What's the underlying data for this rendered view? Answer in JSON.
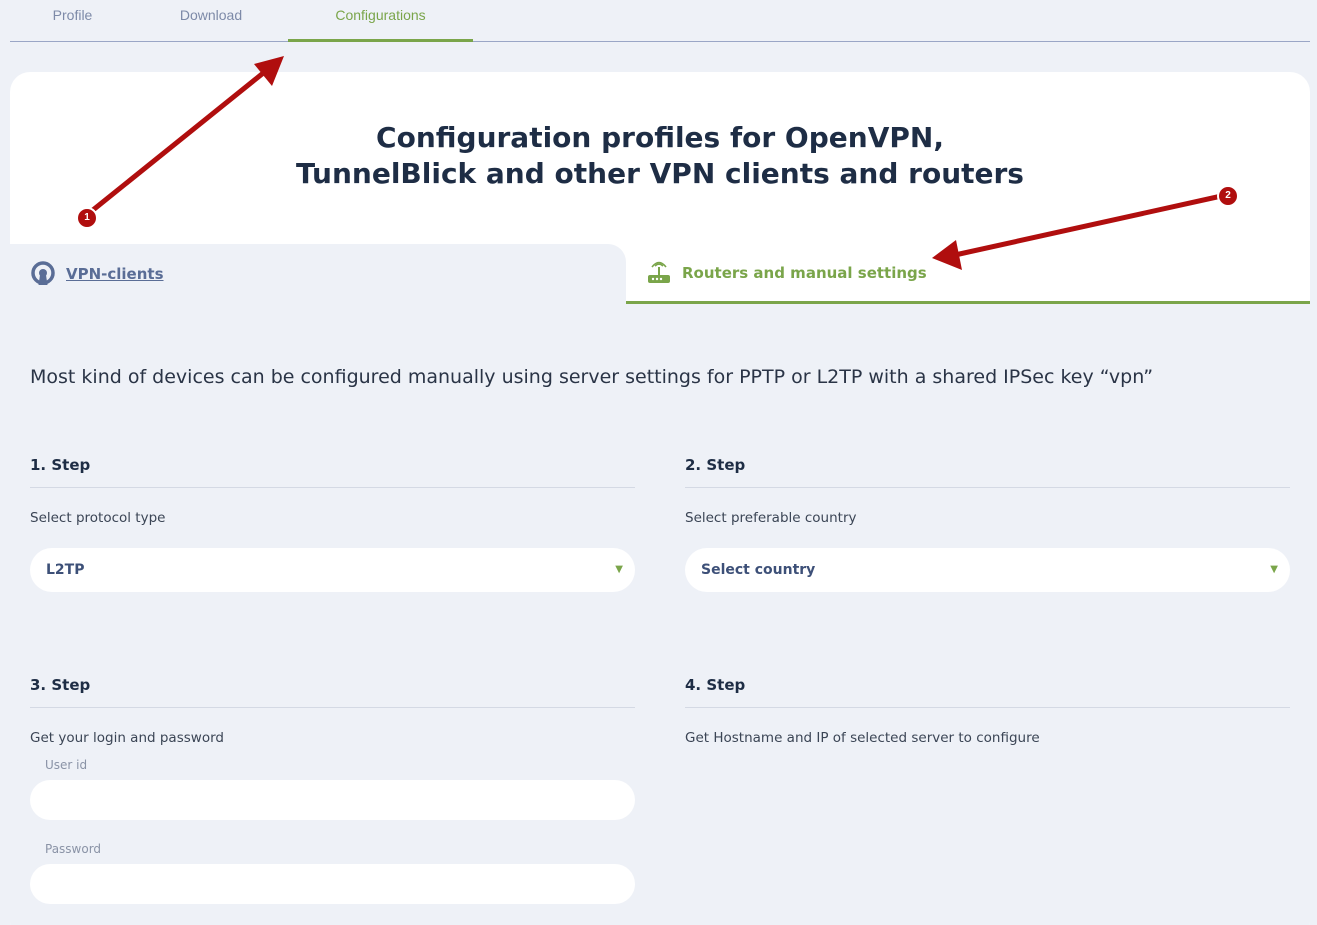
{
  "topnav": {
    "tabs": [
      {
        "label": "Profile"
      },
      {
        "label": "Download"
      },
      {
        "label": "Configurations"
      }
    ]
  },
  "card": {
    "title_line1": "Configuration profiles for OpenVPN,",
    "title_line2": "TunnelBlick and other VPN clients and routers"
  },
  "subtabs": {
    "vpn_clients": "VPN-clients",
    "routers": "Routers and manual settings"
  },
  "intro": "Most kind of devices can be configured manually using server settings for PPTP or L2TP with a shared IPSec key “vpn”",
  "steps": [
    {
      "head": "1. Step",
      "desc": "Select protocol type",
      "select_value": "L2TP"
    },
    {
      "head": "2. Step",
      "desc": "Select preferable country",
      "select_value": "Select country"
    },
    {
      "head": "3. Step",
      "desc": "Get your login and password",
      "user_label": "User id",
      "password_label": "Password"
    },
    {
      "head": "4. Step",
      "desc": "Get Hostname and IP of selected server to configure"
    }
  ],
  "annotations": {
    "badge1": "1",
    "badge2": "2"
  },
  "colors": {
    "accent": "#7aa54a",
    "annotation": "#b00e0e",
    "link": "#5a6d96"
  }
}
